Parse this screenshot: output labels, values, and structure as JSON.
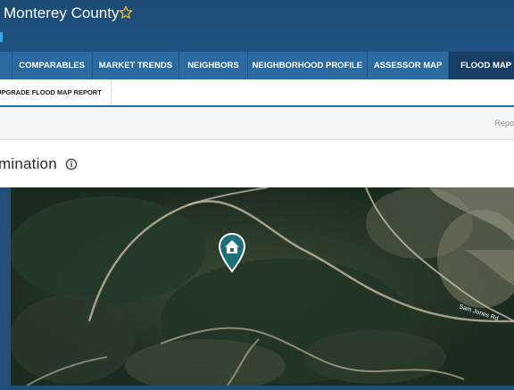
{
  "header": {
    "title": "Monterey County",
    "favorite_icon": "star-outline-icon"
  },
  "nav": {
    "tabs": [
      {
        "label": "COMPARABLES",
        "active": false
      },
      {
        "label": "MARKET TRENDS",
        "active": false
      },
      {
        "label": "NEIGHBORS",
        "active": false
      },
      {
        "label": "NEIGHBORHOOD PROFILE",
        "active": false
      },
      {
        "label": "ASSESSOR MAP",
        "active": false
      },
      {
        "label": "FLOOD MAP",
        "active": true
      }
    ]
  },
  "subnav": {
    "upgrade_label": "UPGRADE FLOOD MAP REPORT"
  },
  "toolbar": {
    "report_label": "Repo"
  },
  "section": {
    "title": "mination",
    "info_icon": "info-icon"
  },
  "map": {
    "road_label": "Sam Jones Rd",
    "marker_icon": "home-map-marker-icon"
  },
  "colors": {
    "header": "#1f5283",
    "nav": "#2a6aa0",
    "nav_active": "#173f63",
    "marker": "#1d6f7a"
  }
}
